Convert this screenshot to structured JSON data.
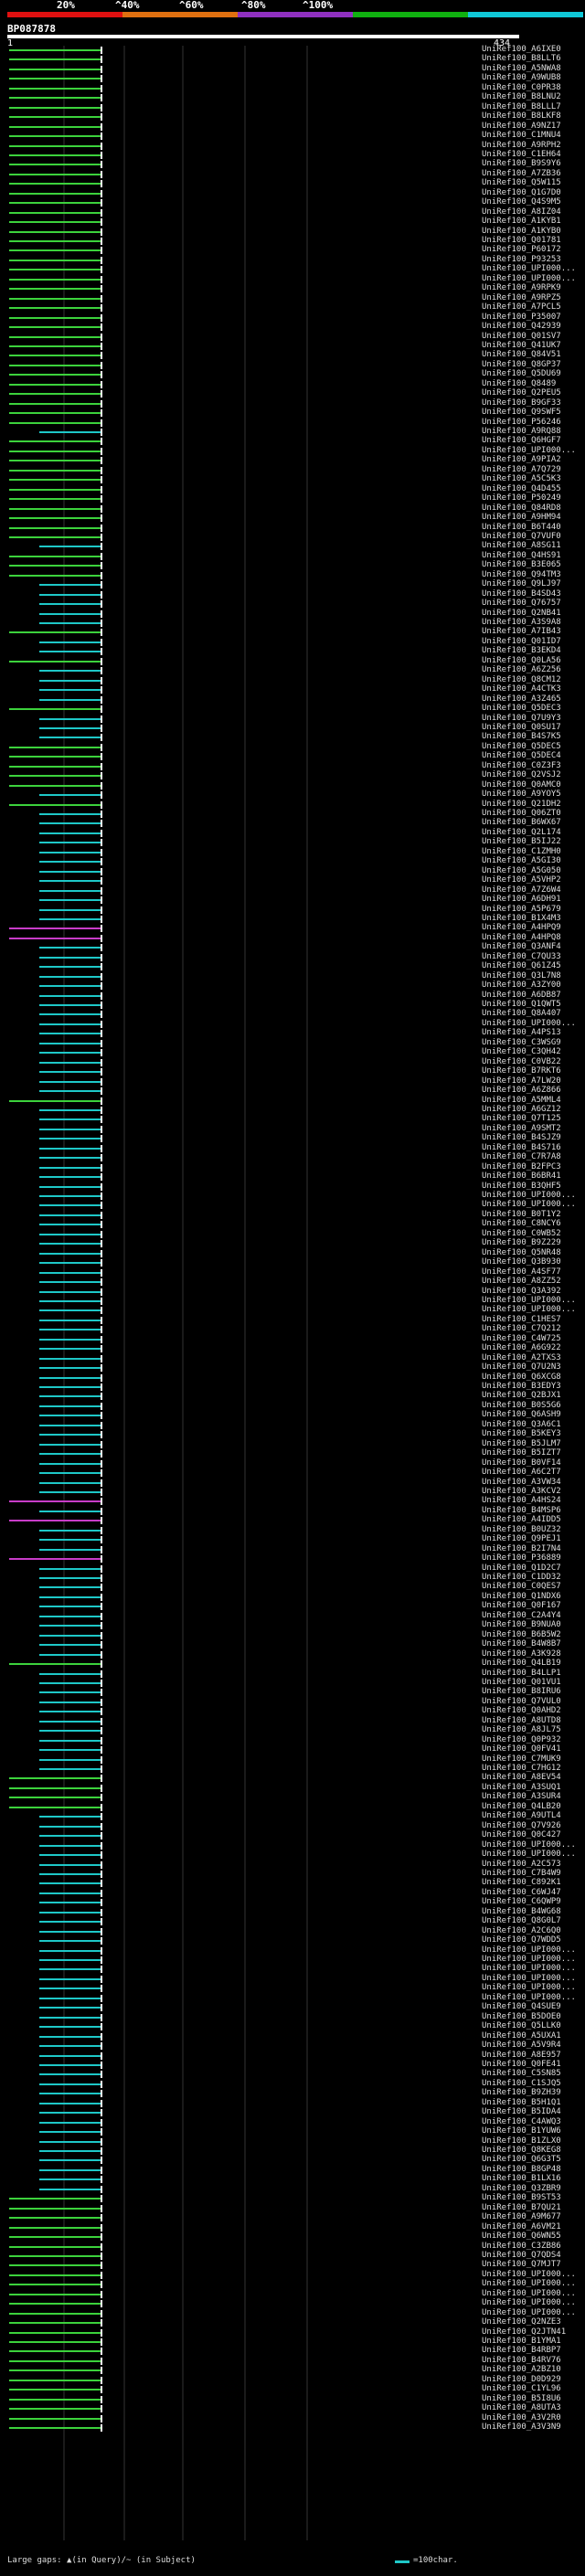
{
  "header": {
    "percent_labels": [
      "20%",
      "^40%",
      "^60%",
      "^80%",
      "^100%"
    ],
    "colors": [
      "#e01010",
      "#e07010",
      "#9030c0",
      "#10b010",
      "#10c8d8"
    ]
  },
  "query": {
    "id": "BP087878",
    "start": "1",
    "end": "434"
  },
  "hits": [
    {
      "label": "UniRef100_A6IXE0",
      "color": "#3cd23c"
    },
    {
      "label": "UniRef100_B8LLT6",
      "color": "#3cd23c"
    },
    {
      "label": "UniRef100_A5NWA8",
      "color": "#3cd23c"
    },
    {
      "label": "UniRef100_A9WUB8",
      "color": "#3cd23c"
    },
    {
      "label": "UniRef100_C0PR38",
      "color": "#3cd23c"
    },
    {
      "label": "UniRef100_B8LNU2",
      "color": "#3cd23c"
    },
    {
      "label": "UniRef100_B8LLL7",
      "color": "#3cd23c"
    },
    {
      "label": "UniRef100_B8LKF8",
      "color": "#3cd23c"
    },
    {
      "label": "UniRef100_A9NZ17",
      "color": "#3cd23c"
    },
    {
      "label": "UniRef100_C1MNU4",
      "color": "#3cd23c"
    },
    {
      "label": "UniRef100_A9RPH2",
      "color": "#3cd23c"
    },
    {
      "label": "UniRef100_C1EH64",
      "color": "#3cd23c"
    },
    {
      "label": "UniRef100_B9S9Y6",
      "color": "#3cd23c"
    },
    {
      "label": "UniRef100_A7ZB36",
      "color": "#3cd23c"
    },
    {
      "label": "UniRef100_Q5W115",
      "color": "#3cd23c"
    },
    {
      "label": "UniRef100_Q1G7D0",
      "color": "#3cd23c"
    },
    {
      "label": "UniRef100_Q4S9M5",
      "color": "#3cd23c"
    },
    {
      "label": "UniRef100_A8IZ04",
      "color": "#3cd23c"
    },
    {
      "label": "UniRef100_A1KYB1",
      "color": "#3cd23c"
    },
    {
      "label": "UniRef100_A1KYB0",
      "color": "#3cd23c"
    },
    {
      "label": "UniRef100_Q01781",
      "color": "#3cd23c"
    },
    {
      "label": "UniRef100_P60172",
      "color": "#3cd23c"
    },
    {
      "label": "UniRef100_P93253",
      "color": "#3cd23c"
    },
    {
      "label": "UniRef100_UPI000...",
      "color": "#3cd23c"
    },
    {
      "label": "UniRef100_UPI000...",
      "color": "#3cd23c"
    },
    {
      "label": "UniRef100_A9RPK9",
      "color": "#3cd23c"
    },
    {
      "label": "UniRef100_A9RPZ5",
      "color": "#3cd23c"
    },
    {
      "label": "UniRef100_A7PCL5",
      "color": "#3cd23c"
    },
    {
      "label": "UniRef100_P35007",
      "color": "#3cd23c"
    },
    {
      "label": "UniRef100_Q42939",
      "color": "#3cd23c"
    },
    {
      "label": "UniRef100_Q01SV7",
      "color": "#3cd23c"
    },
    {
      "label": "UniRef100_Q41UK7",
      "color": "#3cd23c"
    },
    {
      "label": "UniRef100_Q84V51",
      "color": "#3cd23c"
    },
    {
      "label": "UniRef100_Q8GP37",
      "color": "#3cd23c"
    },
    {
      "label": "UniRef100_Q5DU69",
      "color": "#3cd23c"
    },
    {
      "label": "UniRef100_Q8489",
      "color": "#3cd23c"
    },
    {
      "label": "UniRef100_Q2PEU5",
      "color": "#3cd23c"
    },
    {
      "label": "UniRef100_B9GF33",
      "color": "#3cd23c"
    },
    {
      "label": "UniRef100_Q9SWF5",
      "color": "#3cd23c"
    },
    {
      "label": "UniRef100_P56246",
      "color": "#3cd23c"
    },
    {
      "label": "UniRef100_A9RQ88",
      "color": "#1ec8c8"
    },
    {
      "label": "UniRef100_Q6HGF7",
      "color": "#3cd23c"
    },
    {
      "label": "UniRef100_UPI000...",
      "color": "#3cd23c"
    },
    {
      "label": "UniRef100_A9PIA2",
      "color": "#3cd23c"
    },
    {
      "label": "UniRef100_A7Q729",
      "color": "#3cd23c"
    },
    {
      "label": "UniRef100_A5C5K3",
      "color": "#3cd23c"
    },
    {
      "label": "UniRef100_Q4D455",
      "color": "#3cd23c"
    },
    {
      "label": "UniRef100_P50249",
      "color": "#3cd23c"
    },
    {
      "label": "UniRef100_Q84RD8",
      "color": "#3cd23c"
    },
    {
      "label": "UniRef100_A9HM94",
      "color": "#3cd23c"
    },
    {
      "label": "UniRef100_B6T440",
      "color": "#3cd23c"
    },
    {
      "label": "UniRef100_Q7VUF0",
      "color": "#3cd23c"
    },
    {
      "label": "UniRef100_A8SG11",
      "color": "#1ec8c8"
    },
    {
      "label": "UniRef100_Q4HS91",
      "color": "#3cd23c"
    },
    {
      "label": "UniRef100_B3E065",
      "color": "#3cd23c"
    },
    {
      "label": "UniRef100_Q94TM3",
      "color": "#3cd23c"
    },
    {
      "label": "UniRef100_Q9LJ97",
      "color": "#1ec8c8"
    },
    {
      "label": "UniRef100_B4SD43",
      "color": "#1ec8c8"
    },
    {
      "label": "UniRef100_Q76757",
      "color": "#1ec8c8"
    },
    {
      "label": "UniRef100_Q2NB41",
      "color": "#1ec8c8"
    },
    {
      "label": "UniRef100_A3S9A8",
      "color": "#1ec8c8"
    },
    {
      "label": "UniRef100_A7IB43",
      "color": "#3cd23c"
    },
    {
      "label": "UniRef100_Q01ID7",
      "color": "#1ec8c8"
    },
    {
      "label": "UniRef100_B3EKD4",
      "color": "#1ec8c8"
    },
    {
      "label": "UniRef100_Q0LA56",
      "color": "#3cd23c"
    },
    {
      "label": "UniRef100_A6Z256",
      "color": "#1ec8c8"
    },
    {
      "label": "UniRef100_Q8CM12",
      "color": "#1ec8c8"
    },
    {
      "label": "UniRef100_A4CTK3",
      "color": "#1ec8c8"
    },
    {
      "label": "UniRef100_A3Z465",
      "color": "#1ec8c8"
    },
    {
      "label": "UniRef100_Q5DEC3",
      "color": "#3cd23c"
    },
    {
      "label": "UniRef100_Q7U9Y3",
      "color": "#1ec8c8"
    },
    {
      "label": "UniRef100_Q0SU17",
      "color": "#1ec8c8"
    },
    {
      "label": "UniRef100_B4S7K5",
      "color": "#1ec8c8"
    },
    {
      "label": "UniRef100_Q5DEC5",
      "color": "#3cd23c"
    },
    {
      "label": "UniRef100_Q5DEC4",
      "color": "#3cd23c"
    },
    {
      "label": "UniRef100_C0Z3F3",
      "color": "#3cd23c"
    },
    {
      "label": "UniRef100_Q2VSJ2",
      "color": "#3cd23c"
    },
    {
      "label": "UniRef100_Q0AMC0",
      "color": "#3cd23c"
    },
    {
      "label": "UniRef100_A9YOY5",
      "color": "#1ec8c8"
    },
    {
      "label": "UniRef100_Q21DH2",
      "color": "#3cd23c"
    },
    {
      "label": "UniRef100_Q06ZT0",
      "color": "#1ec8c8"
    },
    {
      "label": "UniRef100_B6WX67",
      "color": "#1ec8c8"
    },
    {
      "label": "UniRef100_Q2L174",
      "color": "#1ec8c8"
    },
    {
      "label": "UniRef100_B5IJ22",
      "color": "#1ec8c8"
    },
    {
      "label": "UniRef100_C1ZMH0",
      "color": "#1ec8c8"
    },
    {
      "label": "UniRef100_A5GI30",
      "color": "#1ec8c8"
    },
    {
      "label": "UniRef100_A5G050",
      "color": "#1ec8c8"
    },
    {
      "label": "UniRef100_A5VHP2",
      "color": "#1ec8c8"
    },
    {
      "label": "UniRef100_A7Z6W4",
      "color": "#1ec8c8"
    },
    {
      "label": "UniRef100_A6DH91",
      "color": "#1ec8c8"
    },
    {
      "label": "UniRef100_A5P679",
      "color": "#1ec8c8"
    },
    {
      "label": "UniRef100_B1X4M3",
      "color": "#1ec8c8"
    },
    {
      "label": "UniRef100_A4HPQ9",
      "color": "#c83cc8"
    },
    {
      "label": "UniRef100_A4HPQ8",
      "color": "#c83cc8"
    },
    {
      "label": "UniRef100_Q3ANF4",
      "color": "#1ec8c8"
    },
    {
      "label": "UniRef100_C7QU33",
      "color": "#1ec8c8"
    },
    {
      "label": "UniRef100_Q61Z45",
      "color": "#1ec8c8"
    },
    {
      "label": "UniRef100_Q3L7N8",
      "color": "#1ec8c8"
    },
    {
      "label": "UniRef100_A3ZY00",
      "color": "#1ec8c8"
    },
    {
      "label": "UniRef100_A6DB87",
      "color": "#1ec8c8"
    },
    {
      "label": "UniRef100_Q1QWT5",
      "color": "#1ec8c8"
    },
    {
      "label": "UniRef100_Q8A407",
      "color": "#1ec8c8"
    },
    {
      "label": "UniRef100_UPI000...",
      "color": "#1ec8c8"
    },
    {
      "label": "UniRef100_A4PS13",
      "color": "#1ec8c8"
    },
    {
      "label": "UniRef100_C3WSG9",
      "color": "#1ec8c8"
    },
    {
      "label": "UniRef100_C3QH42",
      "color": "#1ec8c8"
    },
    {
      "label": "UniRef100_C0VB22",
      "color": "#1ec8c8"
    },
    {
      "label": "UniRef100_B7RKT6",
      "color": "#1ec8c8"
    },
    {
      "label": "UniRef100_A7LW20",
      "color": "#1ec8c8"
    },
    {
      "label": "UniRef100_A6Z866",
      "color": "#1ec8c8"
    },
    {
      "label": "UniRef100_A5MML4",
      "color": "#3cd23c"
    },
    {
      "label": "UniRef100_A6GZ12",
      "color": "#1ec8c8"
    },
    {
      "label": "UniRef100_Q7T125",
      "color": "#1ec8c8"
    },
    {
      "label": "UniRef100_A9SMT2",
      "color": "#1ec8c8"
    },
    {
      "label": "UniRef100_B4SJZ9",
      "color": "#1ec8c8"
    },
    {
      "label": "UniRef100_B4S716",
      "color": "#1ec8c8"
    },
    {
      "label": "UniRef100_C7R7A8",
      "color": "#1ec8c8"
    },
    {
      "label": "UniRef100_B2FPC3",
      "color": "#1ec8c8"
    },
    {
      "label": "UniRef100_B6BR41",
      "color": "#1ec8c8"
    },
    {
      "label": "UniRef100_B3QHF5",
      "color": "#1ec8c8"
    },
    {
      "label": "UniRef100_UPI000...",
      "color": "#1ec8c8"
    },
    {
      "label": "UniRef100_UPI000...",
      "color": "#1ec8c8"
    },
    {
      "label": "UniRef100_B0T1Y2",
      "color": "#1ec8c8"
    },
    {
      "label": "UniRef100_C8NCY6",
      "color": "#1ec8c8"
    },
    {
      "label": "UniRef100_C0WB52",
      "color": "#1ec8c8"
    },
    {
      "label": "UniRef100_B9Z229",
      "color": "#1ec8c8"
    },
    {
      "label": "UniRef100_Q5NR48",
      "color": "#1ec8c8"
    },
    {
      "label": "UniRef100_Q3B930",
      "color": "#1ec8c8"
    },
    {
      "label": "UniRef100_A4SF77",
      "color": "#1ec8c8"
    },
    {
      "label": "UniRef100_A8ZZ52",
      "color": "#1ec8c8"
    },
    {
      "label": "UniRef100_Q3A392",
      "color": "#1ec8c8"
    },
    {
      "label": "UniRef100_UPI000...",
      "color": "#1ec8c8"
    },
    {
      "label": "UniRef100_UPI000...",
      "color": "#1ec8c8"
    },
    {
      "label": "UniRef100_C1HES7",
      "color": "#1ec8c8"
    },
    {
      "label": "UniRef100_C7Q212",
      "color": "#1ec8c8"
    },
    {
      "label": "UniRef100_C4W725",
      "color": "#1ec8c8"
    },
    {
      "label": "UniRef100_A6G922",
      "color": "#1ec8c8"
    },
    {
      "label": "UniRef100_A2TXS3",
      "color": "#1ec8c8"
    },
    {
      "label": "UniRef100_Q7U2N3",
      "color": "#1ec8c8"
    },
    {
      "label": "UniRef100_Q6XCG8",
      "color": "#1ec8c8"
    },
    {
      "label": "UniRef100_B3EDY3",
      "color": "#1ec8c8"
    },
    {
      "label": "UniRef100_Q2BJX1",
      "color": "#1ec8c8"
    },
    {
      "label": "UniRef100_B0S5G6",
      "color": "#1ec8c8"
    },
    {
      "label": "UniRef100_Q6ASH9",
      "color": "#1ec8c8"
    },
    {
      "label": "UniRef100_Q3A6C1",
      "color": "#1ec8c8"
    },
    {
      "label": "UniRef100_B5KEY3",
      "color": "#1ec8c8"
    },
    {
      "label": "UniRef100_B5JLM7",
      "color": "#1ec8c8"
    },
    {
      "label": "UniRef100_B5IZT7",
      "color": "#1ec8c8"
    },
    {
      "label": "UniRef100_B0VF14",
      "color": "#1ec8c8"
    },
    {
      "label": "UniRef100_A6C2T7",
      "color": "#1ec8c8"
    },
    {
      "label": "UniRef100_A3VW34",
      "color": "#1ec8c8"
    },
    {
      "label": "UniRef100_A3KCV2",
      "color": "#1ec8c8"
    },
    {
      "label": "UniRef100_A4HS24",
      "color": "#c83cc8"
    },
    {
      "label": "UniRef100_B4MSP6",
      "color": "#1ec8c8"
    },
    {
      "label": "UniRef100_A4IDD5",
      "color": "#c83cc8"
    },
    {
      "label": "UniRef100_B0UZ32",
      "color": "#1ec8c8"
    },
    {
      "label": "UniRef100_Q9PEJ1",
      "color": "#1ec8c8"
    },
    {
      "label": "UniRef100_B2I7N4",
      "color": "#1ec8c8"
    },
    {
      "label": "UniRef100_P36889",
      "color": "#c83cc8"
    },
    {
      "label": "UniRef100_Q1D2C7",
      "color": "#1ec8c8"
    },
    {
      "label": "UniRef100_C1DD32",
      "color": "#1ec8c8"
    },
    {
      "label": "UniRef100_C0QES7",
      "color": "#1ec8c8"
    },
    {
      "label": "UniRef100_Q1NDX6",
      "color": "#1ec8c8"
    },
    {
      "label": "UniRef100_Q0F167",
      "color": "#1ec8c8"
    },
    {
      "label": "UniRef100_C2A4Y4",
      "color": "#1ec8c8"
    },
    {
      "label": "UniRef100_B9NUA0",
      "color": "#1ec8c8"
    },
    {
      "label": "UniRef100_B6B5W2",
      "color": "#1ec8c8"
    },
    {
      "label": "UniRef100_B4W8B7",
      "color": "#1ec8c8"
    },
    {
      "label": "UniRef100_A3K928",
      "color": "#1ec8c8"
    },
    {
      "label": "UniRef100_Q4LB19",
      "color": "#3cd23c"
    },
    {
      "label": "UniRef100_B4LLP1",
      "color": "#1ec8c8"
    },
    {
      "label": "UniRef100_Q01VU1",
      "color": "#1ec8c8"
    },
    {
      "label": "UniRef100_B8IRU6",
      "color": "#1ec8c8"
    },
    {
      "label": "UniRef100_Q7VUL0",
      "color": "#1ec8c8"
    },
    {
      "label": "UniRef100_Q0AHD2",
      "color": "#1ec8c8"
    },
    {
      "label": "UniRef100_A8UTD8",
      "color": "#1ec8c8"
    },
    {
      "label": "UniRef100_A8JL75",
      "color": "#1ec8c8"
    },
    {
      "label": "UniRef100_Q0P932",
      "color": "#1ec8c8"
    },
    {
      "label": "UniRef100_Q0FV41",
      "color": "#1ec8c8"
    },
    {
      "label": "UniRef100_C7MUK9",
      "color": "#1ec8c8"
    },
    {
      "label": "UniRef100_C7HG12",
      "color": "#1ec8c8"
    },
    {
      "label": "UniRef100_A8EV54",
      "color": "#3cd23c"
    },
    {
      "label": "UniRef100_A3SUQ1",
      "color": "#3cd23c"
    },
    {
      "label": "UniRef100_A3SUR4",
      "color": "#3cd23c"
    },
    {
      "label": "UniRef100_Q4LB20",
      "color": "#3cd23c"
    },
    {
      "label": "UniRef100_A9UTL4",
      "color": "#1ec8c8"
    },
    {
      "label": "UniRef100_Q7V926",
      "color": "#1ec8c8"
    },
    {
      "label": "UniRef100_Q0C427",
      "color": "#1ec8c8"
    },
    {
      "label": "UniRef100_UPI000...",
      "color": "#1ec8c8"
    },
    {
      "label": "UniRef100_UPI000...",
      "color": "#1ec8c8"
    },
    {
      "label": "UniRef100_A2C573",
      "color": "#1ec8c8"
    },
    {
      "label": "UniRef100_C7B4W9",
      "color": "#1ec8c8"
    },
    {
      "label": "UniRef100_C892K1",
      "color": "#1ec8c8"
    },
    {
      "label": "UniRef100_C6WJ47",
      "color": "#1ec8c8"
    },
    {
      "label": "UniRef100_C6QWP9",
      "color": "#1ec8c8"
    },
    {
      "label": "UniRef100_B4WG68",
      "color": "#1ec8c8"
    },
    {
      "label": "UniRef100_Q8G0L7",
      "color": "#1ec8c8"
    },
    {
      "label": "UniRef100_A2C6Q0",
      "color": "#1ec8c8"
    },
    {
      "label": "UniRef100_Q7WDD5",
      "color": "#1ec8c8"
    },
    {
      "label": "UniRef100_UPI000...",
      "color": "#1ec8c8"
    },
    {
      "label": "UniRef100_UPI000...",
      "color": "#1ec8c8"
    },
    {
      "label": "UniRef100_UPI000...",
      "color": "#1ec8c8"
    },
    {
      "label": "UniRef100_UPI000...",
      "color": "#1ec8c8"
    },
    {
      "label": "UniRef100_UPI000...",
      "color": "#1ec8c8"
    },
    {
      "label": "UniRef100_UPI000...",
      "color": "#1ec8c8"
    },
    {
      "label": "UniRef100_Q4SUE9",
      "color": "#1ec8c8"
    },
    {
      "label": "UniRef100_B5DOE0",
      "color": "#1ec8c8"
    },
    {
      "label": "UniRef100_Q5LLK0",
      "color": "#1ec8c8"
    },
    {
      "label": "UniRef100_A5UXA1",
      "color": "#1ec8c8"
    },
    {
      "label": "UniRef100_A5V9R4",
      "color": "#1ec8c8"
    },
    {
      "label": "UniRef100_A8E957",
      "color": "#1ec8c8"
    },
    {
      "label": "UniRef100_Q0FE41",
      "color": "#1ec8c8"
    },
    {
      "label": "UniRef100_C5SN85",
      "color": "#1ec8c8"
    },
    {
      "label": "UniRef100_C1SJQ5",
      "color": "#1ec8c8"
    },
    {
      "label": "UniRef100_B9ZH39",
      "color": "#1ec8c8"
    },
    {
      "label": "UniRef100_B5H1Q1",
      "color": "#1ec8c8"
    },
    {
      "label": "UniRef100_B5IDA4",
      "color": "#1ec8c8"
    },
    {
      "label": "UniRef100_C4AWQ3",
      "color": "#1ec8c8"
    },
    {
      "label": "UniRef100_B1YUW6",
      "color": "#1ec8c8"
    },
    {
      "label": "UniRef100_B1ZLX0",
      "color": "#1ec8c8"
    },
    {
      "label": "UniRef100_Q8KEG8",
      "color": "#1ec8c8"
    },
    {
      "label": "UniRef100_Q6G3T5",
      "color": "#1ec8c8"
    },
    {
      "label": "UniRef100_B8GP48",
      "color": "#1ec8c8"
    },
    {
      "label": "UniRef100_B1LX16",
      "color": "#1ec8c8"
    },
    {
      "label": "UniRef100_Q3ZBR9",
      "color": "#1ec8c8"
    },
    {
      "label": "UniRef100_B9ST53",
      "color": "#3cd23c"
    },
    {
      "label": "UniRef100_B7QU21",
      "color": "#3cd23c"
    },
    {
      "label": "UniRef100_A9M677",
      "color": "#3cd23c"
    },
    {
      "label": "UniRef100_A6VM21",
      "color": "#3cd23c"
    },
    {
      "label": "UniRef100_Q6WN55",
      "color": "#3cd23c"
    },
    {
      "label": "UniRef100_C3ZB86",
      "color": "#3cd23c"
    },
    {
      "label": "UniRef100_Q7QDS4",
      "color": "#3cd23c"
    },
    {
      "label": "UniRef100_Q7MJT7",
      "color": "#3cd23c"
    },
    {
      "label": "UniRef100_UPI000...",
      "color": "#3cd23c"
    },
    {
      "label": "UniRef100_UPI000...",
      "color": "#3cd23c"
    },
    {
      "label": "UniRef100_UPI000...",
      "color": "#3cd23c"
    },
    {
      "label": "UniRef100_UPI000...",
      "color": "#3cd23c"
    },
    {
      "label": "UniRef100_UPI000...",
      "color": "#3cd23c"
    },
    {
      "label": "UniRef100_Q2NZE3",
      "color": "#3cd23c"
    },
    {
      "label": "UniRef100_Q2JTN41",
      "color": "#3cd23c"
    },
    {
      "label": "UniRef100_B1YMA1",
      "color": "#3cd23c"
    },
    {
      "label": "UniRef100_B4RBP7",
      "color": "#3cd23c"
    },
    {
      "label": "UniRef100_B4RV76",
      "color": "#3cd23c"
    },
    {
      "label": "UniRef100_A2BZ10",
      "color": "#3cd23c"
    },
    {
      "label": "UniRef100_D0D929",
      "color": "#3cd23c"
    },
    {
      "label": "UniRef100_C1YL96",
      "color": "#3cd23c"
    },
    {
      "label": "UniRef100_B5I8U6",
      "color": "#3cd23c"
    },
    {
      "label": "UniRef100_A8UTA3",
      "color": "#3cd23c"
    },
    {
      "label": "UniRef100_A3V2R0",
      "color": "#3cd23c"
    },
    {
      "label": "UniRef100_A3V3N9",
      "color": "#3cd23c"
    }
  ],
  "footer": {
    "text": "Large gaps: ▲(in Query)/~ (in Subject)",
    "legend": "=100char."
  }
}
